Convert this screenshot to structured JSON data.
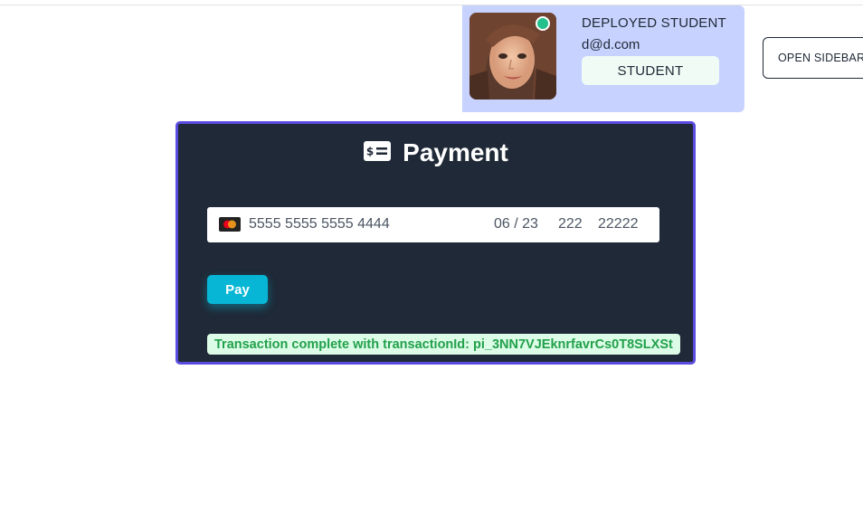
{
  "profile": {
    "name": "DEPLOYED STUDENT",
    "email": "d@d.com",
    "role": "STUDENT",
    "status_color": "#22c08a",
    "card_color": "#c7d2fe"
  },
  "header": {
    "sidebar_button_label": "OPEN SIDEBAR"
  },
  "payment": {
    "title": "Payment",
    "title_icon": "check-cash-icon",
    "card": {
      "brand_icon": "mastercard-icon",
      "number": "5555 5555 5555 4444",
      "expiry": "06 / 23",
      "cvc": "222",
      "zip": "22222"
    },
    "pay_button_label": "Pay",
    "transaction_message": "Transaction complete with transactionId: pi_3NN7VJEknrfavrCs0T8SLXSt",
    "accent_color": "#06b6d4",
    "border_color": "#5b4ce0",
    "success_color": "#22a04b"
  }
}
